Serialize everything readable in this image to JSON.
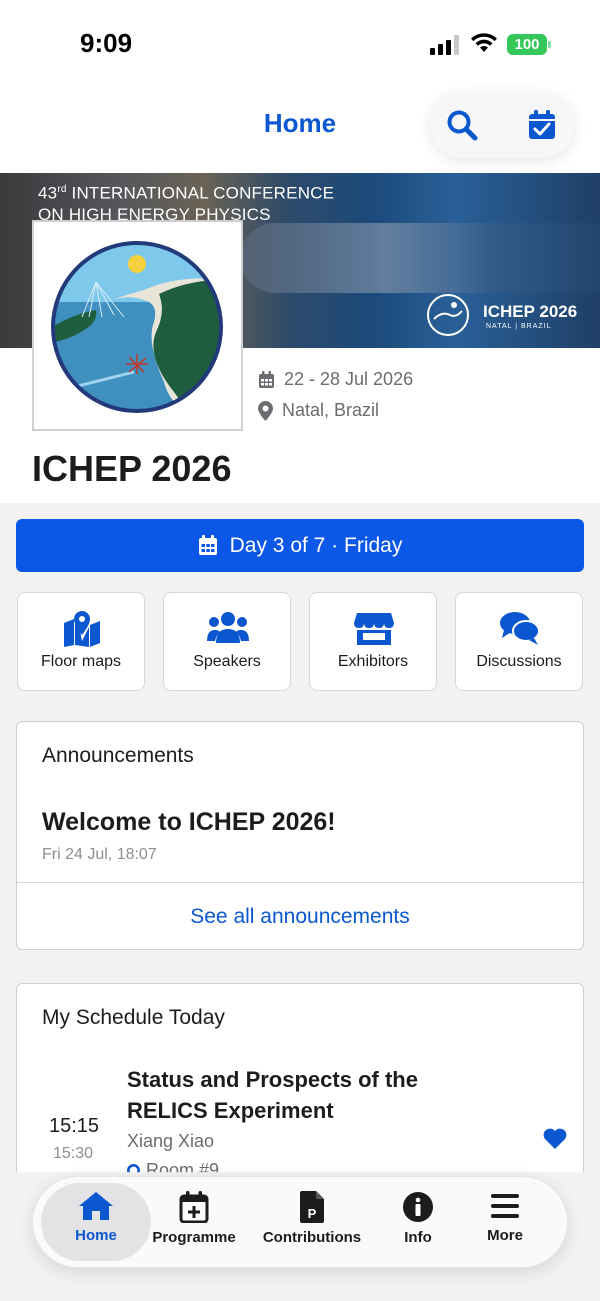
{
  "status_bar": {
    "time": "9:09",
    "battery": "100"
  },
  "nav": {
    "title": "Home",
    "search_icon": "search-icon",
    "calendar_icon": "calendar-check-icon"
  },
  "banner": {
    "line1_prefix": "43",
    "line1_sup": "rd",
    "line1_rest": " INTERNATIONAL CONFERENCE",
    "line2": "ON HIGH ENERGY PHYSICS",
    "logo_title": "ICHEP 2026",
    "logo_subtitle": "NATAL | BRAZIL"
  },
  "event": {
    "dates": "22 - 28 Jul 2026",
    "location": "Natal, Brazil",
    "title": "ICHEP 2026"
  },
  "day_bar": {
    "label": "Day 3 of 7 · Friday"
  },
  "tiles": [
    {
      "label": "Floor maps",
      "icon": "map-pin-icon"
    },
    {
      "label": "Speakers",
      "icon": "users-icon"
    },
    {
      "label": "Exhibitors",
      "icon": "store-icon"
    },
    {
      "label": "Discussions",
      "icon": "comments-icon"
    }
  ],
  "announcements": {
    "heading": "Announcements",
    "title": "Welcome to ICHEP 2026!",
    "date": "Fri 24 Jul, 18:07",
    "link": "See all announcements"
  },
  "schedule": {
    "heading": "My Schedule Today",
    "items": [
      {
        "start": "15:15",
        "end": "15:30",
        "title": "Status and Prospects of the RELICS Experiment",
        "speaker": "Xiang Xiao",
        "room": "Room #9"
      }
    ]
  },
  "tabs": [
    {
      "label": "Home",
      "icon": "home-icon",
      "active": true
    },
    {
      "label": "Programme",
      "icon": "calendar-plus-icon"
    },
    {
      "label": "Contributions",
      "icon": "file-p-icon"
    },
    {
      "label": "Info",
      "icon": "info-icon"
    },
    {
      "label": "More",
      "icon": "menu-icon"
    }
  ],
  "colors": {
    "accent": "#0b57d0",
    "day_bar": "#0b57e8",
    "battery": "#34c759"
  }
}
